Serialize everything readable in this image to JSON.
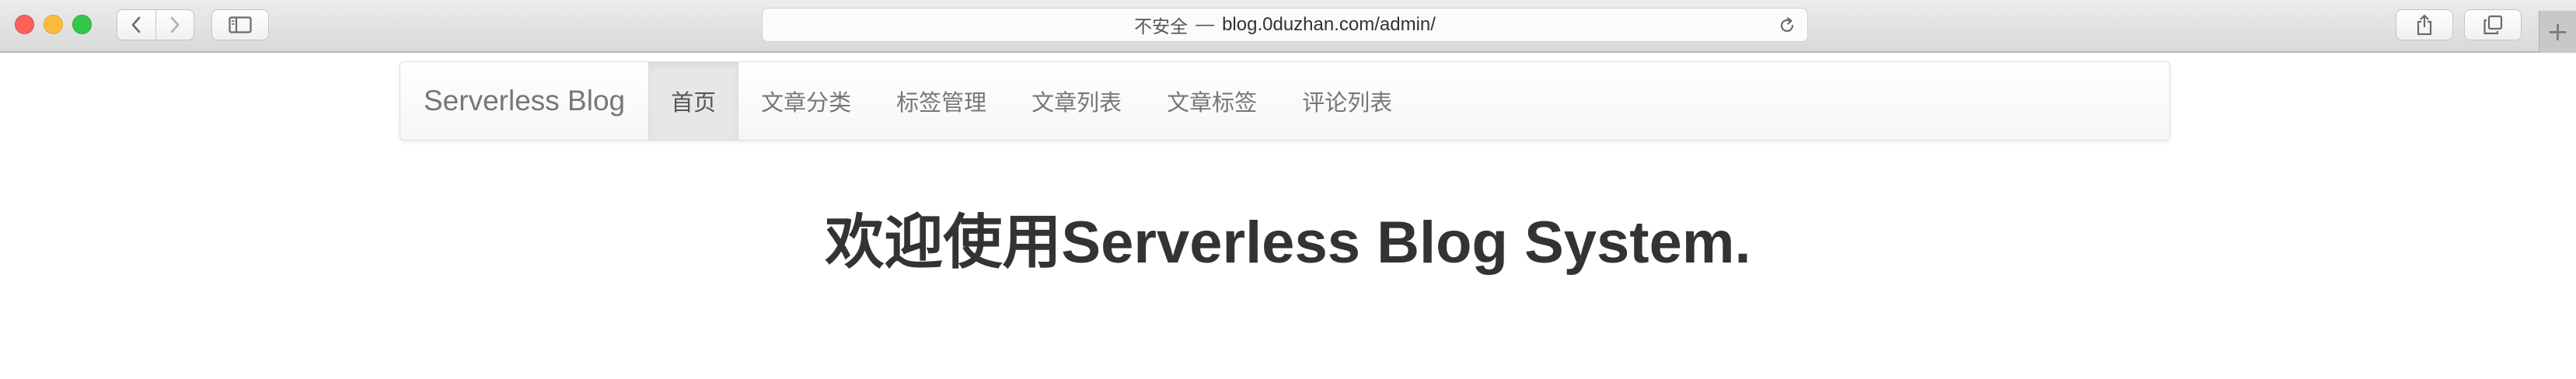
{
  "browser": {
    "address": {
      "security_label": "不安全",
      "separator": "—",
      "url": "blog.0duzhan.com/admin/"
    },
    "icons": {
      "back": "chevron-left-icon",
      "forward": "chevron-right-icon",
      "sidebar": "sidebar-icon",
      "reload": "reload-icon",
      "share": "share-icon",
      "tabs": "tabs-overview-icon",
      "new_tab": "plus-icon"
    },
    "new_tab_label": "+"
  },
  "navbar": {
    "brand": "Serverless Blog",
    "items": [
      {
        "label": "首页",
        "active": true
      },
      {
        "label": "文章分类",
        "active": false
      },
      {
        "label": "标签管理",
        "active": false
      },
      {
        "label": "文章列表",
        "active": false
      },
      {
        "label": "文章标签",
        "active": false
      },
      {
        "label": "评论列表",
        "active": false
      }
    ]
  },
  "main": {
    "heading": "欢迎使用Serverless Blog System."
  }
}
